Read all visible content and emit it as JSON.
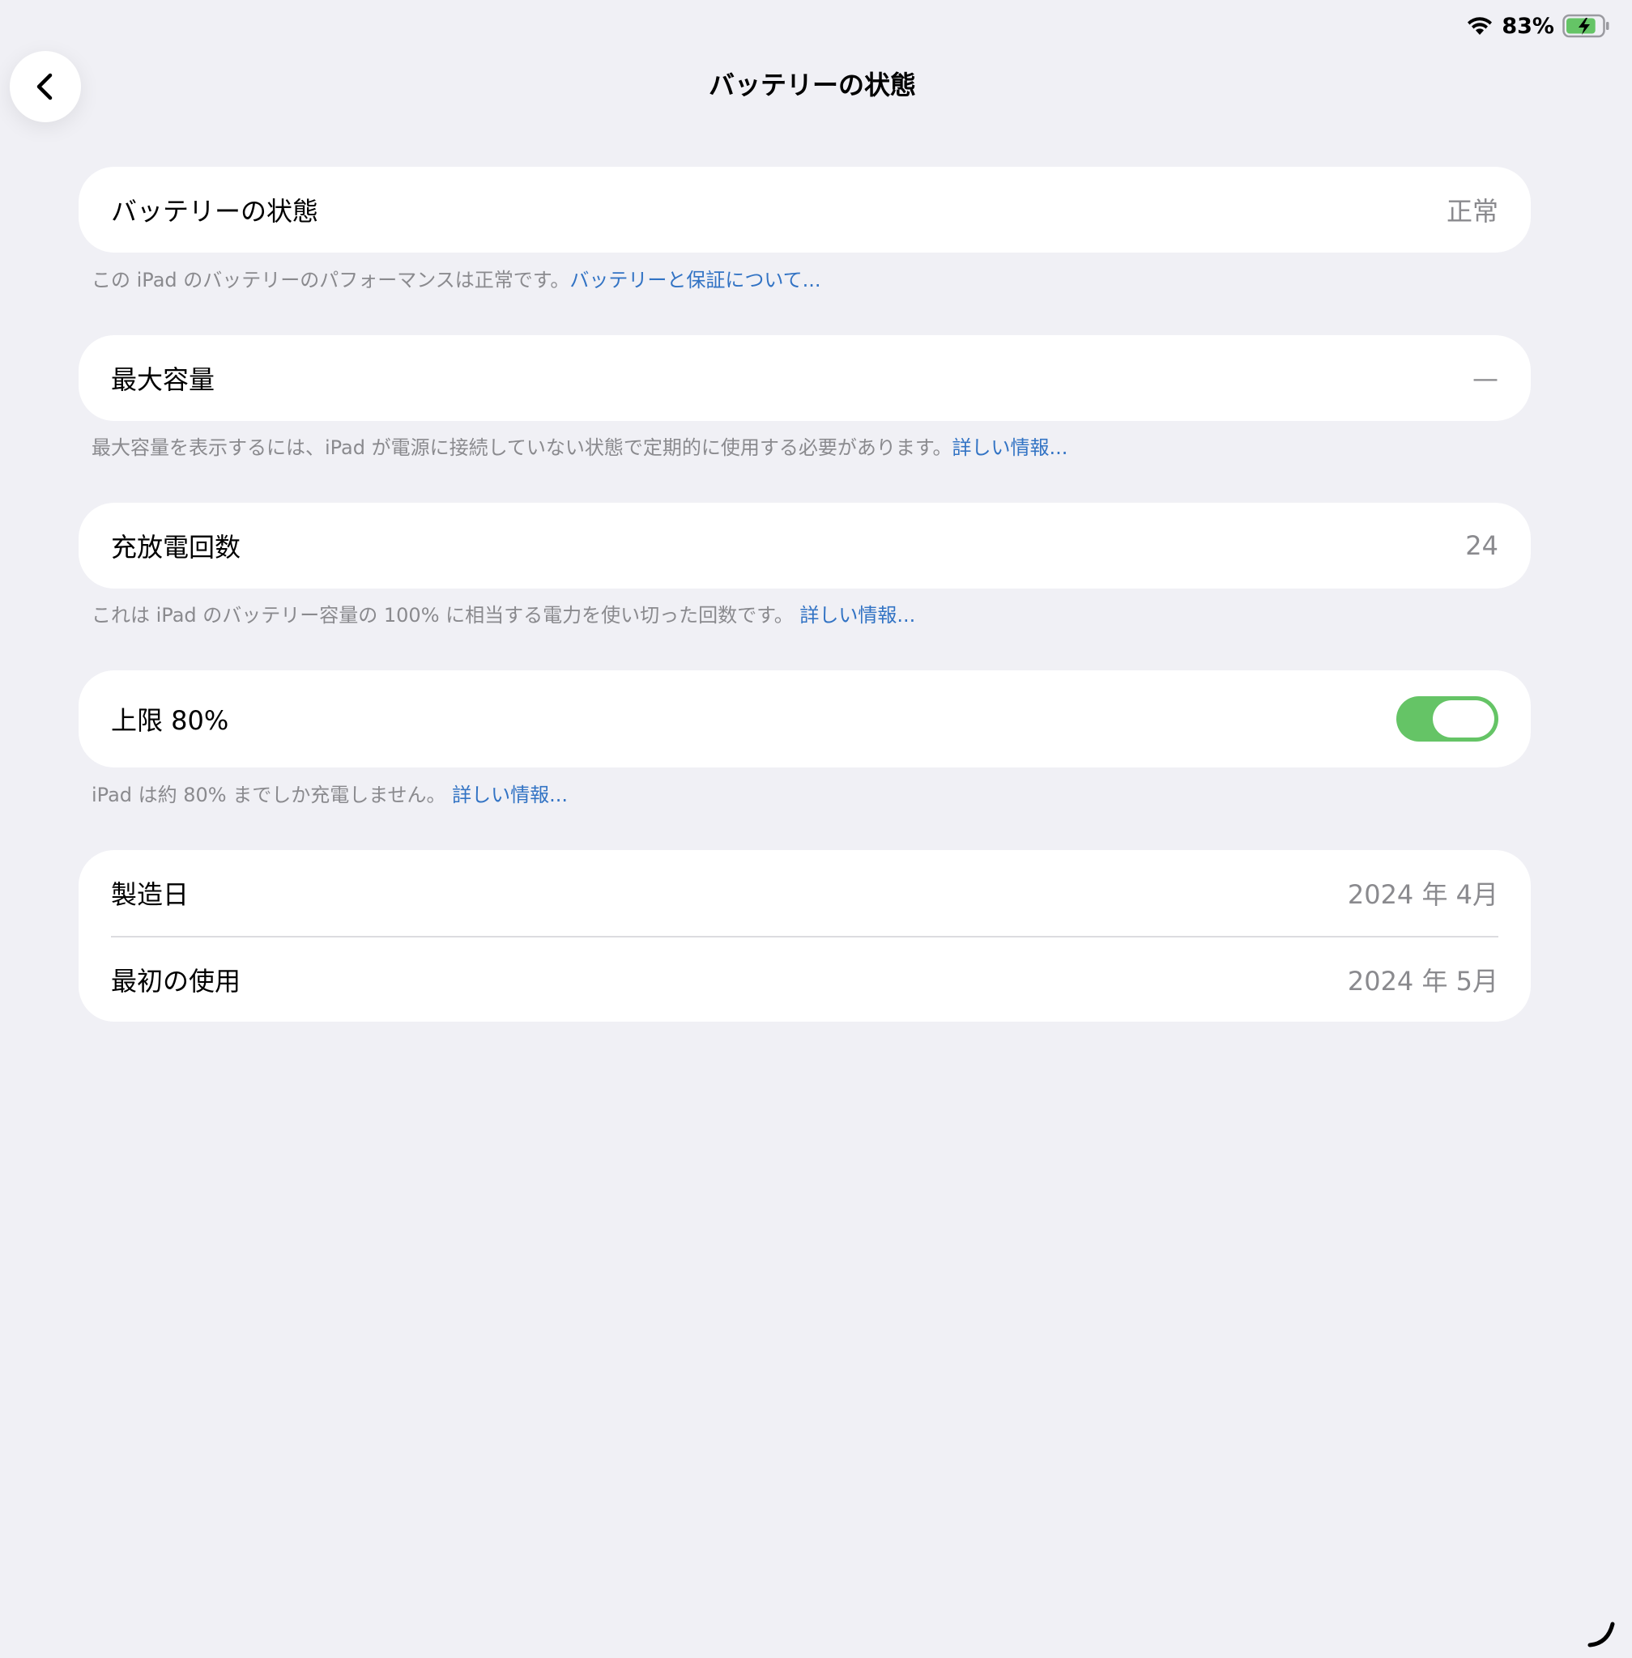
{
  "status_bar": {
    "battery_percent": "83%",
    "battery_level": 0.83,
    "charging": true,
    "battery_fill_color": "#65c466"
  },
  "nav": {
    "back_icon": "chevron-left-icon",
    "title": "バッテリーの状態"
  },
  "sections": {
    "health": {
      "label": "バッテリーの状態",
      "value": "正常",
      "footnote": "この iPad のバッテリーのパフォーマンスは正常です。",
      "link": "バッテリーと保証について..."
    },
    "max_capacity": {
      "label": "最大容量",
      "value": "—",
      "footnote": "最大容量を表示するには、iPad が電源に接続していない状態で定期的に使用する必要があります。",
      "link": "詳しい情報..."
    },
    "cycle_count": {
      "label": "充放電回数",
      "value": "24",
      "footnote": "これは iPad のバッテリー容量の 100% に相当する電力を使い切った回数です。 ",
      "link": "詳しい情報..."
    },
    "limit": {
      "label": "上限 80%",
      "toggle_on": true,
      "toggle_color": "#65c466",
      "footnote": "iPad は約 80% までしか充電しません。 ",
      "link": "詳しい情報..."
    },
    "dates": {
      "manufacture_label": "製造日",
      "manufacture_value": "2024 年 4月",
      "first_use_label": "最初の使用",
      "first_use_value": "2024 年 5月"
    }
  },
  "colors": {
    "background": "#f0f0f5",
    "link": "#3273c4",
    "secondary_text": "#8a8a8e"
  }
}
